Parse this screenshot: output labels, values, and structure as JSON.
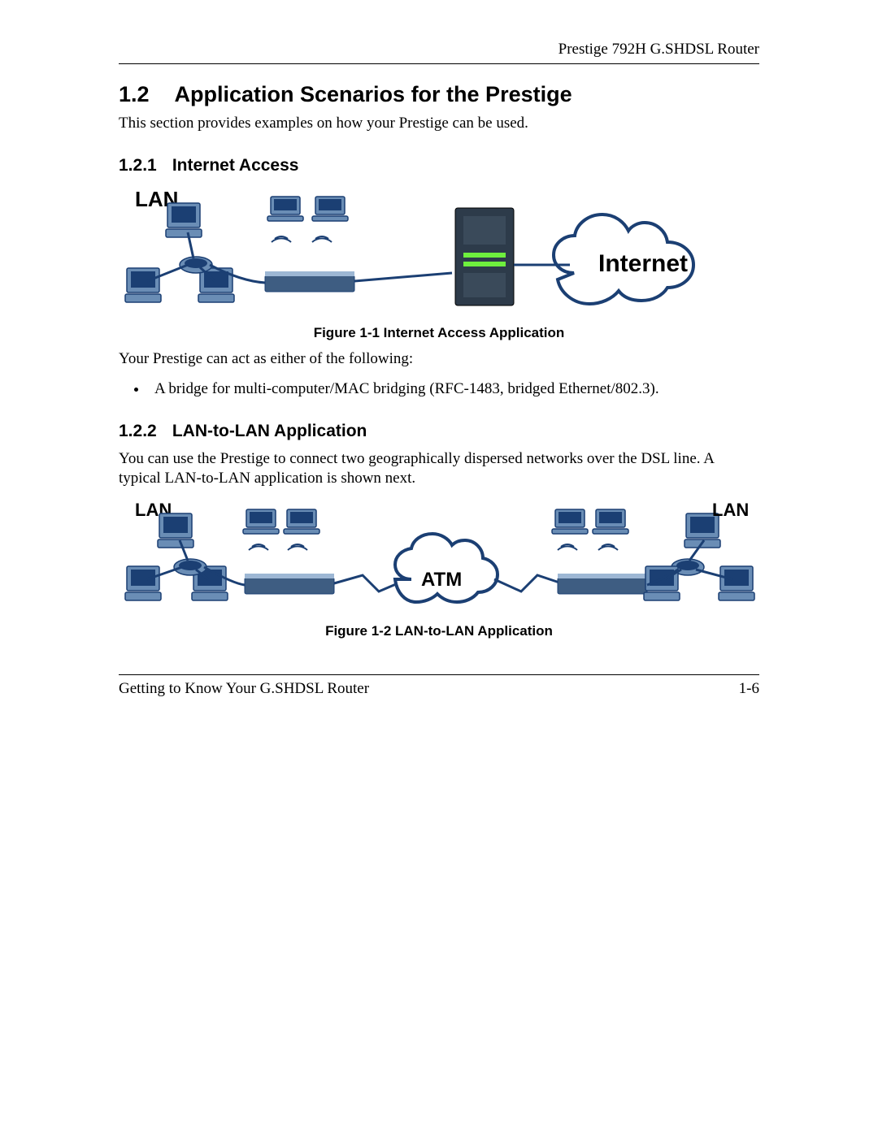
{
  "header": {
    "product": "Prestige 792H G.SHDSL Router"
  },
  "section": {
    "number": "1.2",
    "title": "Application Scenarios for the Prestige",
    "intro": "This section provides examples on how your Prestige can be used."
  },
  "sub1": {
    "number": "1.2.1",
    "title": "Internet Access",
    "figure_label_lan": "LAN",
    "figure_label_internet": "Internet",
    "caption": "Figure 1-1 Internet Access Application",
    "after_fig": "Your Prestige can act as either of the following:",
    "bullet1": "A bridge for multi-computer/MAC bridging (RFC-1483, bridged Ethernet/802.3)."
  },
  "sub2": {
    "number": "1.2.2",
    "title": "LAN-to-LAN Application",
    "para": "You can use the Prestige to connect two geographically dispersed networks over the DSL line.  A typical LAN-to-LAN application is shown next.",
    "figure_label_lan_left": "LAN",
    "figure_label_lan_right": "LAN",
    "figure_label_atm": "ATM",
    "caption": "Figure 1-2 LAN-to-LAN Application"
  },
  "footer": {
    "chapter": "Getting to Know Your G.SHDSL Router",
    "page": "1-6"
  }
}
